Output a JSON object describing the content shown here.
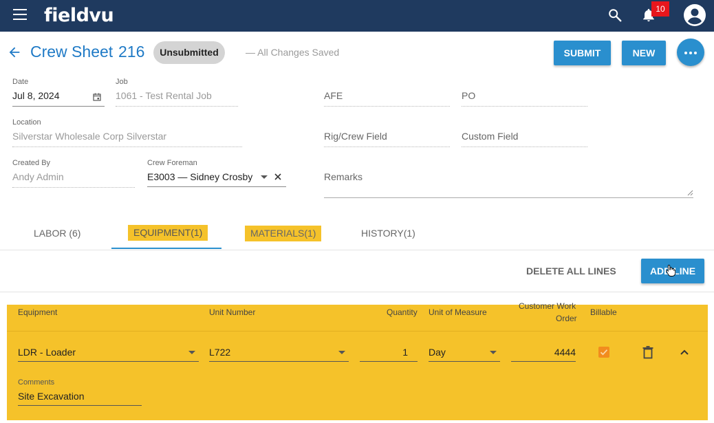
{
  "app": {
    "logo": "fieldvu",
    "notification_count": "10",
    "colors": {
      "navbar": "#1f3a5f",
      "accent": "#2a8fce",
      "title": "#1f7ac6",
      "highlight": "#f5c22a",
      "checkbox": "#f28c1e",
      "badge": "#e8161c"
    },
    "icons": [
      "menu-icon",
      "search-icon",
      "bell-icon",
      "account-icon"
    ]
  },
  "header": {
    "title": "Crew Sheet",
    "number": "216",
    "status": "Unsubmitted",
    "save_status": "— All Changes Saved",
    "submit_label": "SUBMIT",
    "new_label": "NEW"
  },
  "form": {
    "date": {
      "label": "Date",
      "value": "Jul 8, 2024"
    },
    "job": {
      "label": "Job",
      "value": "1061 - Test Rental Job"
    },
    "afe": {
      "placeholder": "AFE"
    },
    "po": {
      "placeholder": "PO"
    },
    "location": {
      "label": "Location",
      "value": "Silverstar Wholesale Corp Silverstar"
    },
    "rig_crew_field": {
      "placeholder": "Rig/Crew Field"
    },
    "custom_field": {
      "placeholder": "Custom Field"
    },
    "created_by": {
      "label": "Created By",
      "value": "Andy Admin"
    },
    "crew_foreman": {
      "label": "Crew Foreman",
      "value": "E3003 — Sidney Crosby"
    },
    "remarks": {
      "placeholder": "Remarks"
    }
  },
  "tabs": [
    {
      "label": "LABOR (6)",
      "active": false,
      "highlighted": false
    },
    {
      "label": "EQUIPMENT(1)",
      "active": true,
      "highlighted": true
    },
    {
      "label": "MATERIALS(1)",
      "active": false,
      "highlighted": true
    },
    {
      "label": "HISTORY(1)",
      "active": false,
      "highlighted": false
    }
  ],
  "actions": {
    "delete_all": "DELETE ALL LINES",
    "add_line": "ADD LINE"
  },
  "table": {
    "columns": {
      "equipment": "Equipment",
      "unit_number": "Unit Number",
      "quantity": "Quantity",
      "unit_of_measure": "Unit of Measure",
      "customer_work_order_1": "Customer Work",
      "customer_work_order_2": "Order",
      "billable": "Billable"
    },
    "rows": [
      {
        "equipment": "LDR - Loader",
        "unit_number": "L722",
        "quantity": "1",
        "unit_of_measure": "Day",
        "customer_work_order": "4444",
        "billable": true,
        "comments_label": "Comments",
        "comments": "Site Excavation"
      }
    ]
  }
}
